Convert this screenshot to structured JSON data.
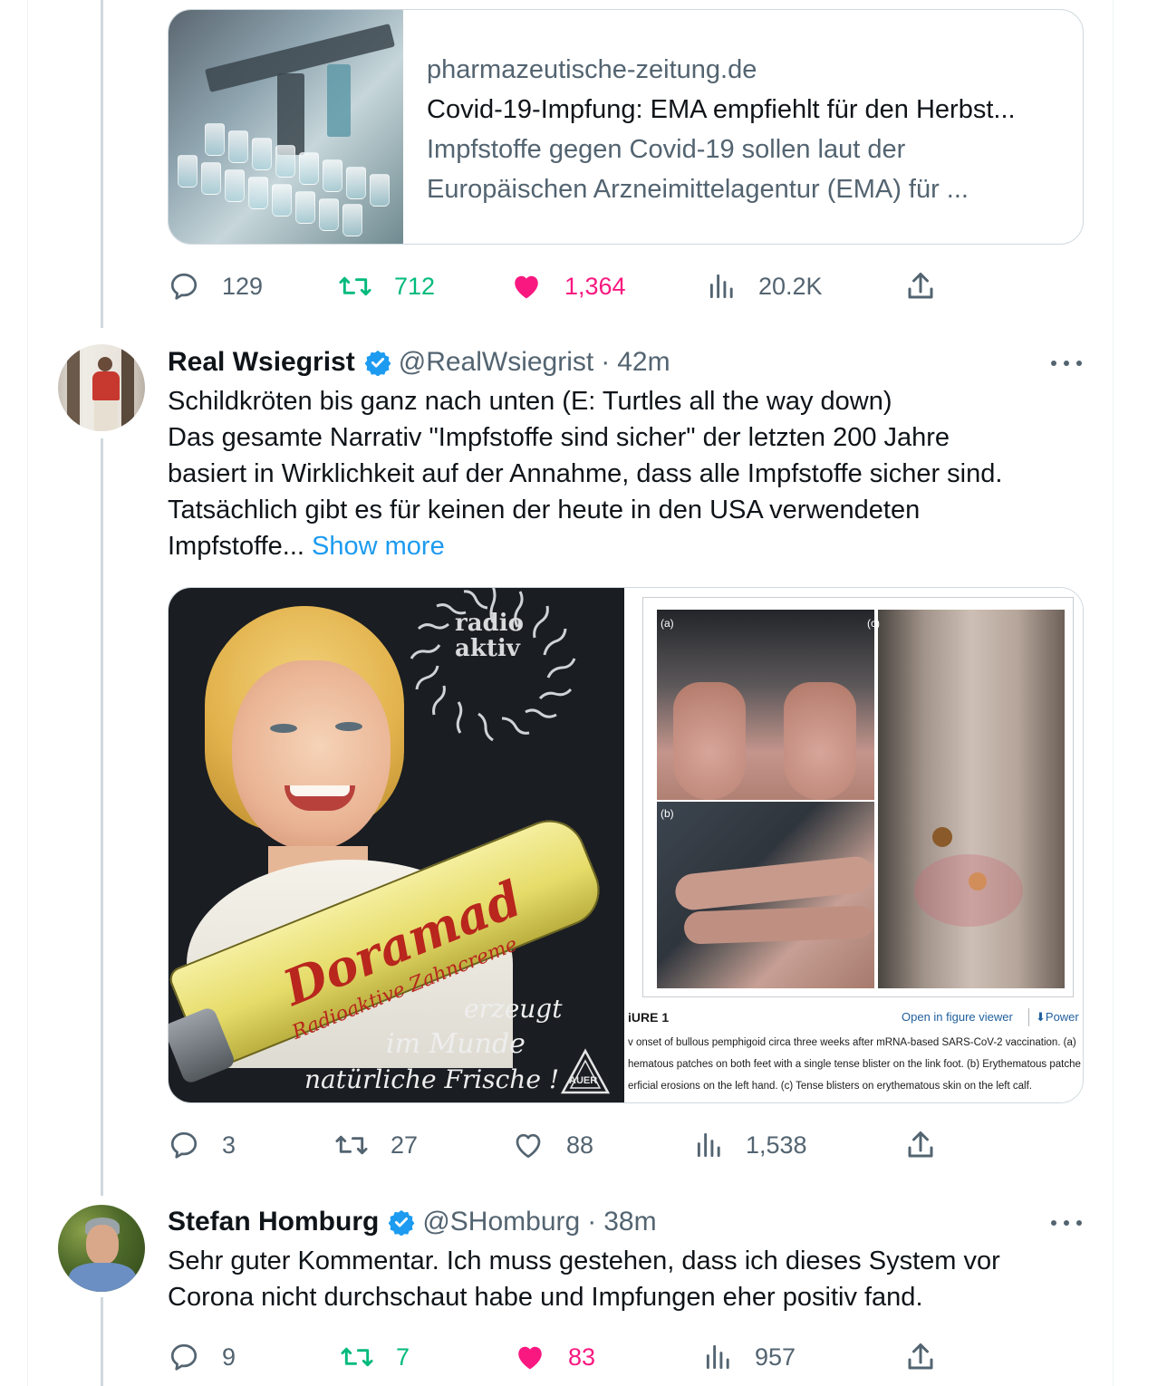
{
  "link_card": {
    "domain": "pharmazeutische-zeitung.de",
    "title": "Covid-19-Impfung: EMA empfiehlt für den Herbst...",
    "description_line1": "Impfstoffe gegen Covid-19 sollen laut der",
    "description_line2": "Europäischen Arzneimittelagentur (EMA) für ..."
  },
  "tweets": [
    {
      "replies": "129",
      "retweets": "712",
      "likes": "1,364",
      "views": "20.2K",
      "retweeted": true,
      "liked": true
    },
    {
      "name": "Real Wsiegrist",
      "handle": "@RealWsiegrist",
      "separator": "·",
      "time": "42m",
      "text_lines": [
        "Schildkröten bis ganz nach unten (E: Turtles all the way down)",
        "Das gesamte Narrativ \"Impfstoffe sind sicher\" der letzten 200 Jahre",
        "basiert in Wirklichkeit auf der Annahme, dass alle Impfstoffe sicher sind.",
        "Tatsächlich gibt es für keinen der heute in den USA verwendeten",
        "Impfstoffe..."
      ],
      "show_more": "Show more",
      "media": {
        "ad_burst_line1": "radio",
        "ad_burst_line2": "aktiv",
        "ad_brand": "Doramad",
        "ad_product": "Radioaktive Zahncreme",
        "ad_slogan1": "erzeugt",
        "ad_slogan2": "im Munde",
        "ad_slogan3": "natürliche Frische !",
        "ad_logo": "AUER",
        "figure_labels": [
          "(a)",
          "(b)",
          "(c)"
        ],
        "figure_title": "iURE 1",
        "figure_link": "Open in figure viewer",
        "figure_power": "⬇Power",
        "caption_line1": "v onset of bullous pemphigoid circa three weeks after mRNA-based SARS-CoV-2 vaccination. (a)",
        "caption_line2": "hematous patches on both feet with a single tense blister on the link foot. (b) Erythematous patche",
        "caption_line3": "erficial erosions on the left hand. (c) Tense blisters on erythematous skin on the left calf."
      },
      "replies": "3",
      "retweets": "27",
      "likes": "88",
      "views": "1,538",
      "retweeted": false,
      "liked": false
    },
    {
      "name": "Stefan Homburg",
      "handle": "@SHomburg",
      "separator": "·",
      "time": "38m",
      "text_lines": [
        "Sehr guter Kommentar. Ich muss gestehen, dass ich dieses System vor",
        "Corona nicht durchschaut habe und Impfungen eher positiv fand."
      ],
      "replies": "9",
      "retweets": "7",
      "likes": "83",
      "views": "957",
      "retweeted": true,
      "liked": true
    }
  ],
  "colors": {
    "accent": "#1d9bf0",
    "retweet": "#00ba7c",
    "like": "#f91880",
    "muted": "#536471",
    "text": "#0f1419"
  }
}
